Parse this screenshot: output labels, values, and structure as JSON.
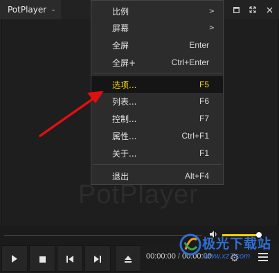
{
  "app": {
    "name": "PotPlayer",
    "watermark": "PotPlayer"
  },
  "titlebar": {
    "menu_label": "PotPlayer",
    "chevron": "⌄",
    "window_controls": [
      "pin",
      "minimize",
      "restore",
      "fullscreen",
      "close"
    ]
  },
  "context_menu": {
    "items": [
      {
        "label": "比例",
        "shortcut": "",
        "submenu": true
      },
      {
        "label": "屏幕",
        "shortcut": "",
        "submenu": true
      },
      {
        "label": "全屏",
        "shortcut": "Enter",
        "submenu": false
      },
      {
        "label": "全屏+",
        "shortcut": "Ctrl+Enter",
        "submenu": false
      },
      {
        "label": "选项...",
        "shortcut": "F5",
        "submenu": false,
        "selected": true
      },
      {
        "label": "列表...",
        "shortcut": "F6",
        "submenu": false
      },
      {
        "label": "控制...",
        "shortcut": "F7",
        "submenu": false
      },
      {
        "label": "属性...",
        "shortcut": "Ctrl+F1",
        "submenu": false
      },
      {
        "label": "关于...",
        "shortcut": "F1",
        "submenu": false
      },
      {
        "label": "退出",
        "shortcut": "Alt+F4",
        "submenu": false
      }
    ],
    "submenu_arrow": ">"
  },
  "playback": {
    "current_time": "00:00:00",
    "separator": "/",
    "total_time": "00:00:00",
    "volume_fraction": 0.95,
    "seek_fraction": 0.0
  },
  "controls": [
    "play-icon",
    "stop-icon",
    "prev-icon",
    "next-icon",
    "eject-icon",
    "gear-icon",
    "menu-icon"
  ],
  "site_logo": {
    "text": "极光下载站",
    "url": "www.xz7.com"
  },
  "colors": {
    "accent": "#f5d300",
    "annotation_arrow": "#e01010",
    "logo": "#2f6fd6"
  }
}
